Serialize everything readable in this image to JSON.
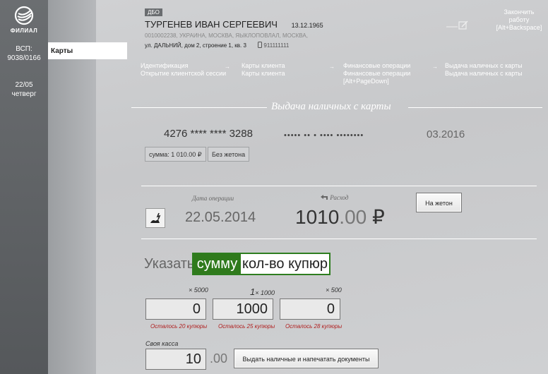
{
  "sidebar": {
    "brand": "ФИЛИАЛ",
    "vsp_label": "ВСП:",
    "vsp_code": "9038/0166",
    "date": "22/05",
    "weekday": "четверг"
  },
  "nav": {
    "cards": "Карты"
  },
  "client": {
    "badge": "ДБО",
    "name": "ТУРГЕНЕВ ИВАН СЕРГЕЕВИЧ",
    "dob": "13.12.1965",
    "address1": "0010002238, УКРАИНА, МОСКВА, ЯЫКЛОПОВЛАЛ, МОСКВА,",
    "address2": "ул. ДАЛЬНИЙ, дом 2, строение 1, кв. 3",
    "phone": "911111111"
  },
  "finish": {
    "line1": "Закончить",
    "line2": "работу",
    "line3": "[Alt+Backspace]"
  },
  "steps": [
    {
      "l1": "Идентификация",
      "l2": "Открытие клиентской сессии",
      "l3": ""
    },
    {
      "l1": "Карты клиента",
      "l2": "Карты клиента",
      "l3": ""
    },
    {
      "l1": "Финансовые операции",
      "l2": "Финансовые операции",
      "l3": "[Alt+PageDown]"
    },
    {
      "l1": "Выдача наличных с карты",
      "l2": "Выдача наличных с карты",
      "l3": ""
    }
  ],
  "section_title": "Выдача наличных с карты",
  "card": {
    "number": "4276 **** **** 3288",
    "holder": "••••• •• • •••• ••••••••",
    "expiry": "03.2016",
    "sum_tag": "сумма: 1 010.00 ₽",
    "token_tag": "Без жетона"
  },
  "operation": {
    "date_label": "Дата операции",
    "date": "22.05.2014",
    "type_label": "Расход",
    "amount_int": "1010",
    "amount_dec": ".00",
    "currency": "₽",
    "token_button": "На жетон"
  },
  "specify": {
    "label": "Указать",
    "option_sum": "сумму",
    "option_count": "кол-во купюр"
  },
  "denominations": [
    {
      "label": "× 5000",
      "prefix": "",
      "value": "0",
      "left": "Осталось 20 купюры"
    },
    {
      "label": "× 1000",
      "prefix": "1",
      "value": "1000",
      "left": "Осталось 25 купюры"
    },
    {
      "label": "× 500",
      "prefix": "",
      "value": "0",
      "left": "Осталось 28 купюры"
    }
  ],
  "kassa": {
    "label": "Своя касса",
    "value": "10",
    "dec": ".00"
  },
  "issue_button": "Выдать наличные и напечатать документы"
}
